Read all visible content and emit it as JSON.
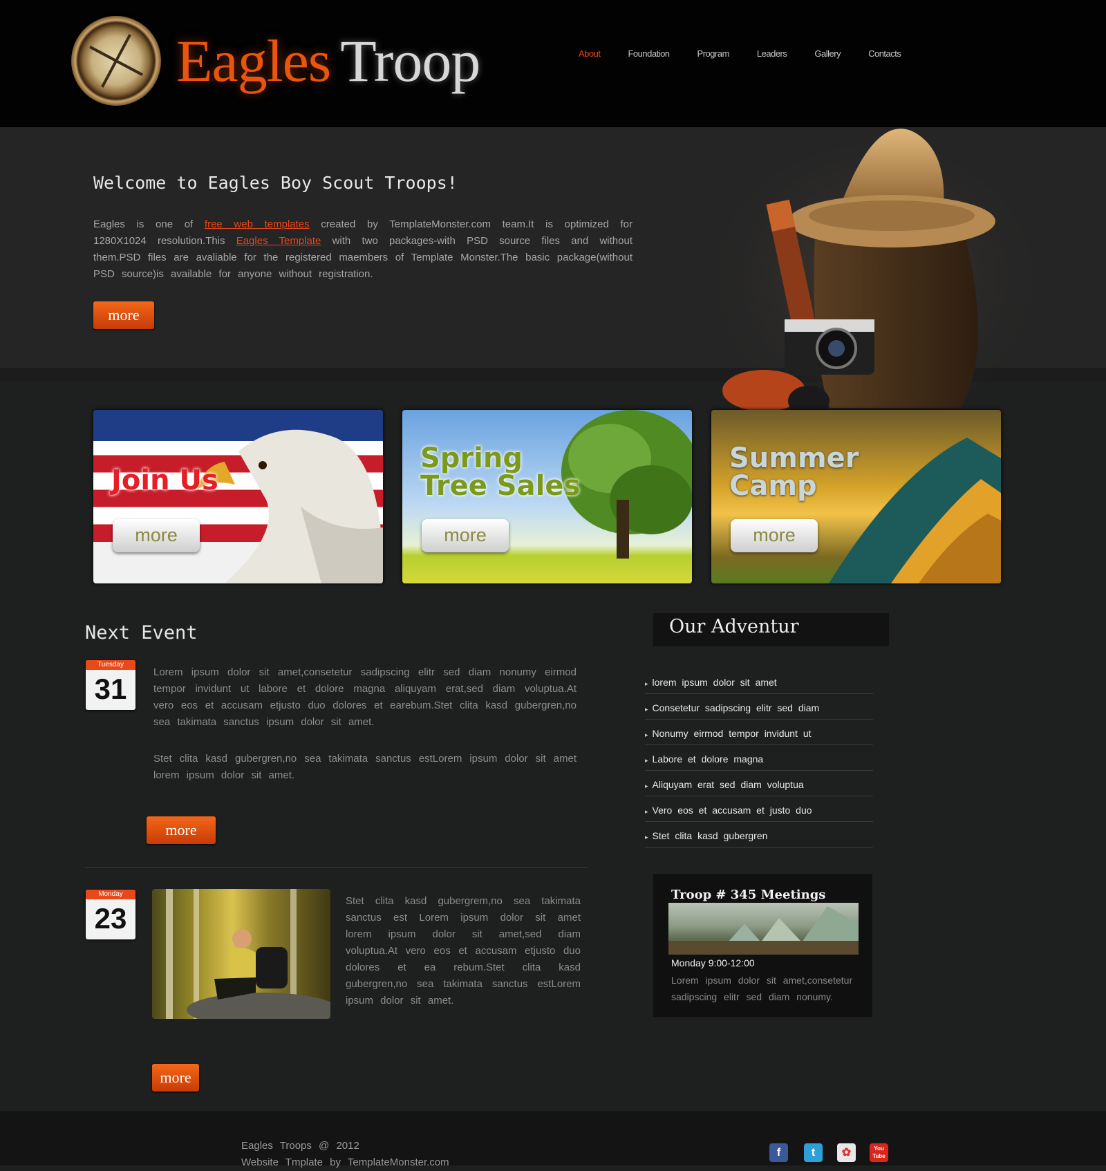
{
  "header": {
    "logo_part1": "Eagles",
    "logo_part2": "Troop",
    "nav": [
      {
        "label": "About"
      },
      {
        "label": "Foundation"
      },
      {
        "label": "Program"
      },
      {
        "label": "Leaders"
      },
      {
        "label": "Gallery"
      },
      {
        "label": "Contacts"
      }
    ]
  },
  "hero": {
    "title": "Welcome to Eagles Boy Scout Troops!",
    "intro_1": "Eagles is one of ",
    "intro_link1": "free web templates",
    "intro_2": " created by TemplateMonster.com team.It is optimized for 1280X1024 resolution.This ",
    "intro_link2": "Eagles Template",
    "intro_3": " with two packages-with PSD source files and without them.PSD files are avaliable for the registered maembers of Template Monster.The basic package(without PSD source)is available for anyone without registration.",
    "more_label": "more"
  },
  "banners": [
    {
      "title": "Join Us",
      "more": "more"
    },
    {
      "title_l1": "Spring",
      "title_l2": "Tree Sales",
      "more": "more"
    },
    {
      "title_l1": "Summer",
      "title_l2": "Camp",
      "more": "more"
    }
  ],
  "events": {
    "title": "Next Event",
    "items": [
      {
        "day": "Tuesday",
        "date": "31",
        "text1": "Lorem ipsum dolor sit amet,consetetur sadipscing elitr sed diam nonumy eirmod tempor invidunt ut labore et dolore magna aliquyam erat,sed diam voluptua.At vero eos et accusam etjusto duo dolores et earebum.Stet clita kasd gubergren,no sea takimata sanctus ipsum dolor sit amet.",
        "text2": "Stet clita kasd gubergren,no sea takimata sanctus estLorem ipsum dolor sit amet lorem ipsum dolor sit amet.",
        "more": "more"
      },
      {
        "day": "Monday",
        "date": "23",
        "text1": "Stet clita kasd gubergrem,no sea takimata sanctus est Lorem ipsum dolor sit amet lorem ipsum dolor sit amet,sed diam voluptua.At vero eos et accusam etjusto duo dolores et ea rebum.Stet clita kasd gubergren,no sea takimata sanctus estLorem ipsum dolor sit amet.",
        "more": "more"
      }
    ]
  },
  "adventure": {
    "title": "Our Adventur",
    "items": [
      "lorem ipsum dolor sit amet",
      "Consetetur sadipscing elitr sed diam",
      "Nonumy eirmod tempor invidunt ut",
      "Labore et dolore magna",
      "Aliquyam erat sed diam voluptua",
      "Vero eos et accusam et justo duo",
      "Stet clita kasd gubergren"
    ]
  },
  "troop": {
    "title": "Troop # 345 Meetings",
    "schedule": "Monday  9:00-12:00",
    "text": "Lorem ipsum dolor sit amet,consetetur sadipscing elitr sed diam nonumy."
  },
  "footer": {
    "line1": "Eagles Troops @ 2012",
    "line2": "Website Tmplate by TemplateMonster.com",
    "social": [
      {
        "name": "facebook-icon",
        "glyph": "f",
        "color": "#3b5998"
      },
      {
        "name": "twitter-icon",
        "glyph": "t",
        "color": "#2fa0d6"
      },
      {
        "name": "picasa-icon",
        "glyph": "✿",
        "color": "#e8e8e8"
      },
      {
        "name": "youtube-icon",
        "glyph": "You Tube",
        "color": "#d9261c"
      }
    ]
  },
  "colors": {
    "accent": "#e8481a",
    "background": "#1e1f1f",
    "header": "#020202"
  }
}
